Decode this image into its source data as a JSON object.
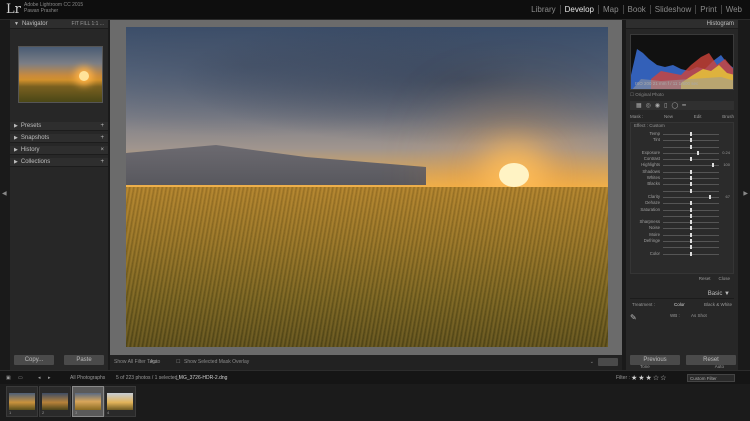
{
  "app": {
    "logo": "Lr",
    "catalog_line1": "Adobe Lightroom CC 2015",
    "catalog_line2": "Pawan Prasher"
  },
  "modules": [
    "Library",
    "Develop",
    "Map",
    "Book",
    "Slideshow",
    "Print",
    "Web"
  ],
  "active_module": "Develop",
  "left_panel": {
    "navigator": {
      "title": "Navigator",
      "options": "FIT  FILL  1:1  ..."
    },
    "sections": [
      "Presets",
      "Snapshots",
      "History",
      "Collections"
    ],
    "copy_label": "Copy...",
    "paste_label": "Paste"
  },
  "center_toolbar": {
    "soft_proofing_label": "Show All Filter Tags",
    "auto_label": "Auto",
    "show_selected_label": "Show Selected Mask Overlay"
  },
  "right_panel": {
    "histogram_title": "Histogram",
    "histogram_readout": "ISO 200    21 mm    f / 11    1/500 sec",
    "original_photo": "Original Photo",
    "mask_label": "Mask :",
    "new_label": "New",
    "edit_label": "Edit",
    "brush_label": "Brush",
    "effect_label": "Effect :",
    "effect_value": "Custom",
    "sliders": [
      {
        "label": "Temp",
        "pos": 0.5,
        "value": ""
      },
      {
        "label": "Tint",
        "pos": 0.5,
        "value": ""
      },
      {
        "label": "",
        "pos": 0.5,
        "value": ""
      },
      {
        "label": "Exposure",
        "pos": 0.62,
        "value": "0.24"
      },
      {
        "label": "Contrast",
        "pos": 0.5,
        "value": ""
      },
      {
        "label": "Highlights",
        "pos": 0.9,
        "value": "100"
      },
      {
        "label": "Shadows",
        "pos": 0.5,
        "value": ""
      },
      {
        "label": "Whites",
        "pos": 0.5,
        "value": ""
      },
      {
        "label": "Blacks",
        "pos": 0.5,
        "value": ""
      },
      {
        "label": "",
        "pos": 0.5,
        "value": ""
      },
      {
        "label": "Clarity",
        "pos": 0.84,
        "value": "67"
      },
      {
        "label": "Dehaze",
        "pos": 0.5,
        "value": ""
      },
      {
        "label": "Saturation",
        "pos": 0.5,
        "value": ""
      },
      {
        "label": "",
        "pos": 0.5,
        "value": ""
      },
      {
        "label": "Sharpness",
        "pos": 0.5,
        "value": ""
      },
      {
        "label": "Noise",
        "pos": 0.5,
        "value": ""
      },
      {
        "label": "Moire",
        "pos": 0.5,
        "value": ""
      },
      {
        "label": "Defringe",
        "pos": 0.5,
        "value": ""
      },
      {
        "label": "",
        "pos": 0.5,
        "value": ""
      },
      {
        "label": "Color",
        "pos": 0.5,
        "value": ""
      }
    ],
    "reset_label": "Reset",
    "close_label": "Close",
    "basic_title": "Basic",
    "treatment_label": "Treatment :",
    "color_label": "Color",
    "bw_label": "Black & White",
    "wb_label": "WB :",
    "wb_value": "As Shot",
    "tone_label": "Tone",
    "tone_auto": "Auto",
    "previous_label": "Previous",
    "reset_button_label": "Reset"
  },
  "filmstrip": {
    "source": "All Photographs",
    "count": "5 of 223 photos / 1 selected /",
    "filename": "_MG_3726-HDR-2.dng",
    "filter_label": "Filter :",
    "stars": "★★★☆☆",
    "custom_filter": "Custom Filter",
    "thumbs": [
      {
        "caption": "1",
        "selected": false
      },
      {
        "caption": "2",
        "selected": false
      },
      {
        "caption": "3",
        "selected": true
      },
      {
        "caption": "4",
        "selected": false
      }
    ]
  },
  "colors": {
    "accent_text": "#e6e6e6",
    "panel_bg": "#272727",
    "histogram_blue": "#3a6fd6",
    "histogram_red": "#d0443a",
    "histogram_yellow": "#e6c43a"
  }
}
